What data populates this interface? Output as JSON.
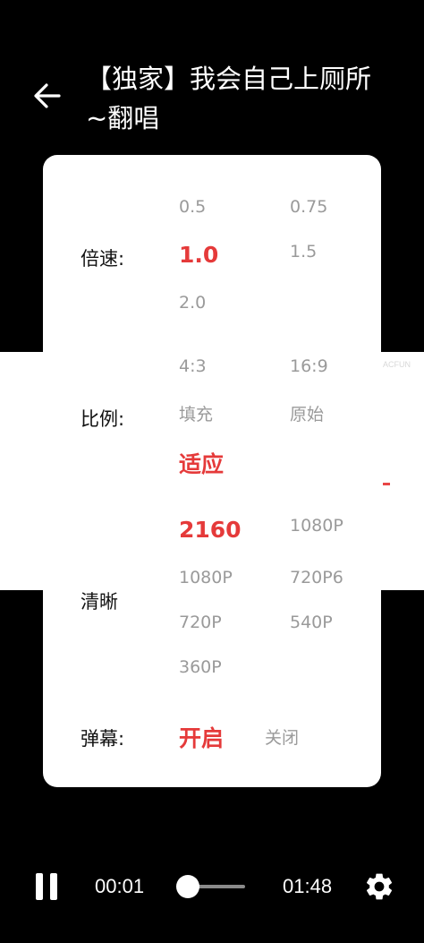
{
  "header": {
    "title": "【独家】我会自己上厕所~翻唱"
  },
  "video": {
    "watermark": "ACFUN"
  },
  "settings": {
    "speed": {
      "label": "倍速:",
      "options": [
        "0.5",
        "0.75",
        "1.0",
        "1.5",
        "2.0"
      ],
      "selected": "1.0"
    },
    "ratio": {
      "label": "比例:",
      "options": [
        "4:3",
        "16:9",
        "填充",
        "原始",
        "适应"
      ],
      "selected": "适应"
    },
    "quality": {
      "label": "清晰",
      "options": [
        "2160",
        "1080P",
        "1080P",
        "720P6",
        "720P",
        "540P",
        "360P"
      ],
      "selected": "2160"
    },
    "danmaku": {
      "label": "弹幕:",
      "options": [
        "开启",
        "关闭"
      ],
      "selected": "开启"
    }
  },
  "player": {
    "current_time": "00:01",
    "duration": "01:48",
    "progress": 0.01
  },
  "icons": {
    "back": "arrow-left-icon",
    "pause": "pause-icon",
    "settings": "gear-icon"
  },
  "colors": {
    "accent": "#e53a3a",
    "inactive": "#9a9a9a"
  }
}
